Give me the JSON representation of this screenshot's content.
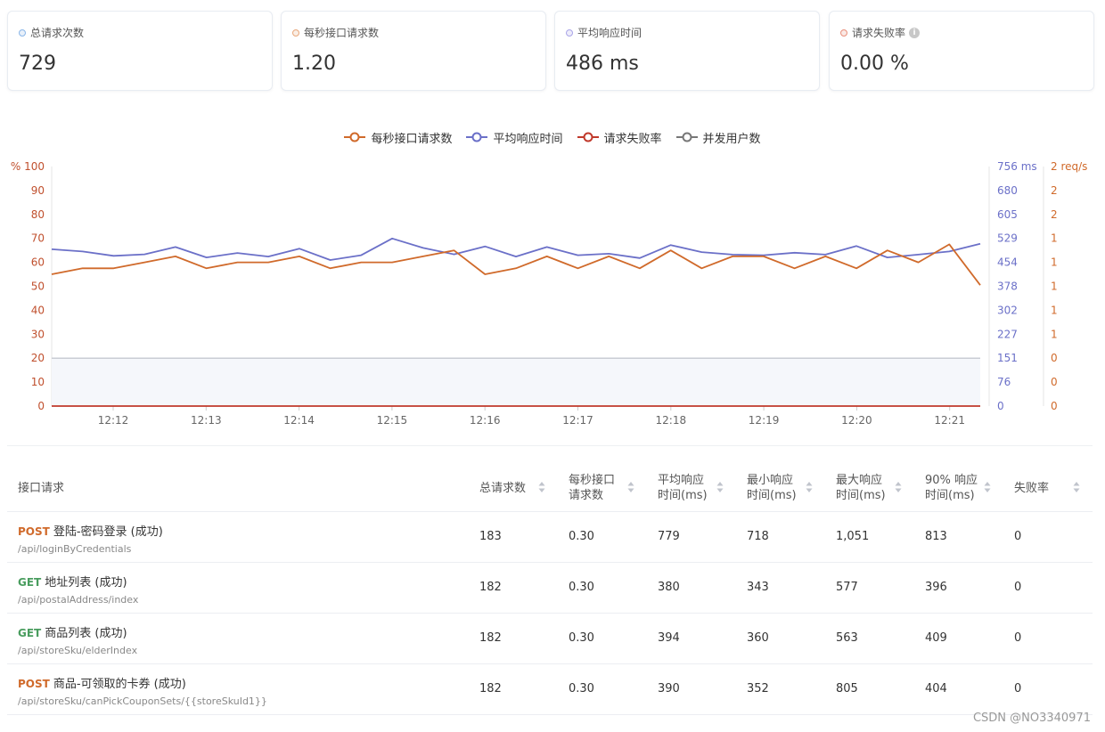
{
  "stats": [
    {
      "label": "总请求次数",
      "value": "729",
      "dot": "#8ab6e8",
      "info": false
    },
    {
      "label": "每秒接口请求数",
      "value": "1.20",
      "dot": "#e8a87c",
      "info": false
    },
    {
      "label": "平均响应时间",
      "value": "486 ms",
      "dot": "#a9a4e8",
      "info": false
    },
    {
      "label": "请求失败率",
      "value": "0.00 %",
      "dot": "#e8907c",
      "info": true
    }
  ],
  "chart_data": {
    "type": "line",
    "legend_position": "top-center",
    "x": [
      "12:12",
      "12:13",
      "12:14",
      "12:15",
      "12:16",
      "12:17",
      "12:18",
      "12:19",
      "12:20",
      "12:21"
    ],
    "y_left": {
      "ticks": [
        "% 100",
        "90",
        "80",
        "70",
        "60",
        "50",
        "40",
        "30",
        "20",
        "10",
        "0"
      ],
      "range": [
        0,
        100
      ],
      "color": "#c0502e"
    },
    "y_right_ms": {
      "ticks": [
        "756 ms",
        "680",
        "605",
        "529",
        "454",
        "378",
        "302",
        "227",
        "151",
        "76",
        "0"
      ],
      "range": [
        0,
        756
      ],
      "color": "#6b70c8"
    },
    "y_right_rps": {
      "ticks": [
        "2 req/s",
        "2",
        "2",
        "1",
        "1",
        "1",
        "1",
        "1",
        "0",
        "0",
        "0"
      ],
      "range": [
        0,
        2
      ],
      "color": "#d06a2b"
    },
    "series": [
      {
        "name": "每秒接口请求数",
        "color": "#d06a2b",
        "axis": "left",
        "values": [
          55,
          57.5,
          57.5,
          60,
          62.5,
          57.5,
          60,
          60,
          62.5,
          57.5,
          60,
          60,
          62.5,
          65,
          55,
          57.5,
          62.5,
          57.5,
          62.5,
          57.5,
          65,
          57.5,
          62.5,
          62.5,
          57.5,
          62.5,
          57.5,
          65,
          60,
          67.5,
          50.5
        ]
      },
      {
        "name": "平均响应时间",
        "color": "#6b70c8",
        "axis": "right_ms",
        "values": [
          495,
          488,
          474,
          479,
          502,
          469,
          483,
          472,
          497,
          461,
          476,
          529,
          499,
          479,
          504,
          472,
          502,
          476,
          481,
          467,
          508,
          486,
          478,
          476,
          484,
          478,
          505,
          469,
          478,
          488,
          512
        ]
      },
      {
        "name": "请求失败率",
        "color": "#c0392b",
        "axis": "left",
        "values": [
          0,
          0,
          0,
          0,
          0,
          0,
          0,
          0,
          0,
          0,
          0,
          0,
          0,
          0,
          0,
          0,
          0,
          0,
          0,
          0,
          0,
          0,
          0,
          0,
          0,
          0,
          0,
          0,
          0,
          0,
          0
        ]
      },
      {
        "name": "并发用户数",
        "color": "#777777",
        "axis": "left",
        "constant": 20
      }
    ]
  },
  "table": {
    "headers": [
      "接口请求",
      "总请求数",
      "每秒接口\n请求数",
      "平均响应\n时间(ms)",
      "最小响应\n时间(ms)",
      "最大响应\n时间(ms)",
      "90% 响应\n时间(ms)",
      "失败率"
    ],
    "rows": [
      {
        "method": "POST",
        "name": "登陆-密码登录 (成功)",
        "path": "/api/loginByCredentials",
        "cells": [
          "183",
          "0.30",
          "779",
          "718",
          "1,051",
          "813",
          "0"
        ]
      },
      {
        "method": "GET",
        "name": "地址列表 (成功)",
        "path": "/api/postalAddress/index",
        "cells": [
          "182",
          "0.30",
          "380",
          "343",
          "577",
          "396",
          "0"
        ]
      },
      {
        "method": "GET",
        "name": "商品列表 (成功)",
        "path": "/api/storeSku/elderIndex",
        "cells": [
          "182",
          "0.30",
          "394",
          "360",
          "563",
          "409",
          "0"
        ]
      },
      {
        "method": "POST",
        "name": "商品-可领取的卡券 (成功)",
        "path": "/api/storeSku/canPickCouponSets/{{storeSkuId1}}",
        "cells": [
          "182",
          "0.30",
          "390",
          "352",
          "805",
          "404",
          "0"
        ]
      }
    ]
  },
  "watermark": "CSDN @NO3340971"
}
